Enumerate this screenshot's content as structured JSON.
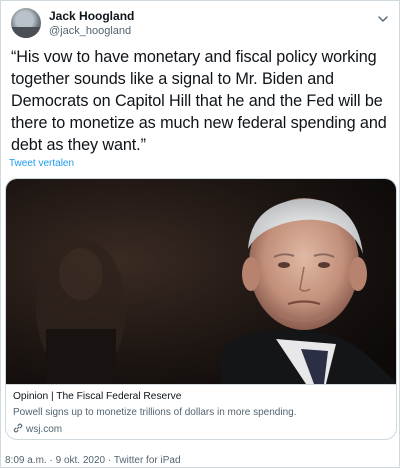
{
  "author": {
    "name": "Jack Hoogland",
    "handle": "@jack_hoogland"
  },
  "tweet": {
    "text": "“His vow to have monetary and fiscal policy working together sounds like a signal to Mr. Biden and Democrats on Capitol Hill that he and the Fed will be there to monetize as much new federal spending and debt as they want.”",
    "translate_label": "Tweet vertalen"
  },
  "card": {
    "title": "Opinion | The Fiscal Federal Reserve",
    "description": "Powell signs up to monetize trillions of dollars in more spending.",
    "domain": "wsj.com",
    "domain_icon": "link-icon"
  },
  "meta": {
    "time": "8:09 a.m.",
    "separator": "·",
    "date": "9 okt. 2020",
    "source": "Twitter for iPad"
  },
  "icons": {
    "menu": "chevron-down-icon",
    "avatar": "avatar-image"
  },
  "colors": {
    "link": "#1d9bf0",
    "secondary_text": "#536471",
    "border": "#cfd9de"
  }
}
